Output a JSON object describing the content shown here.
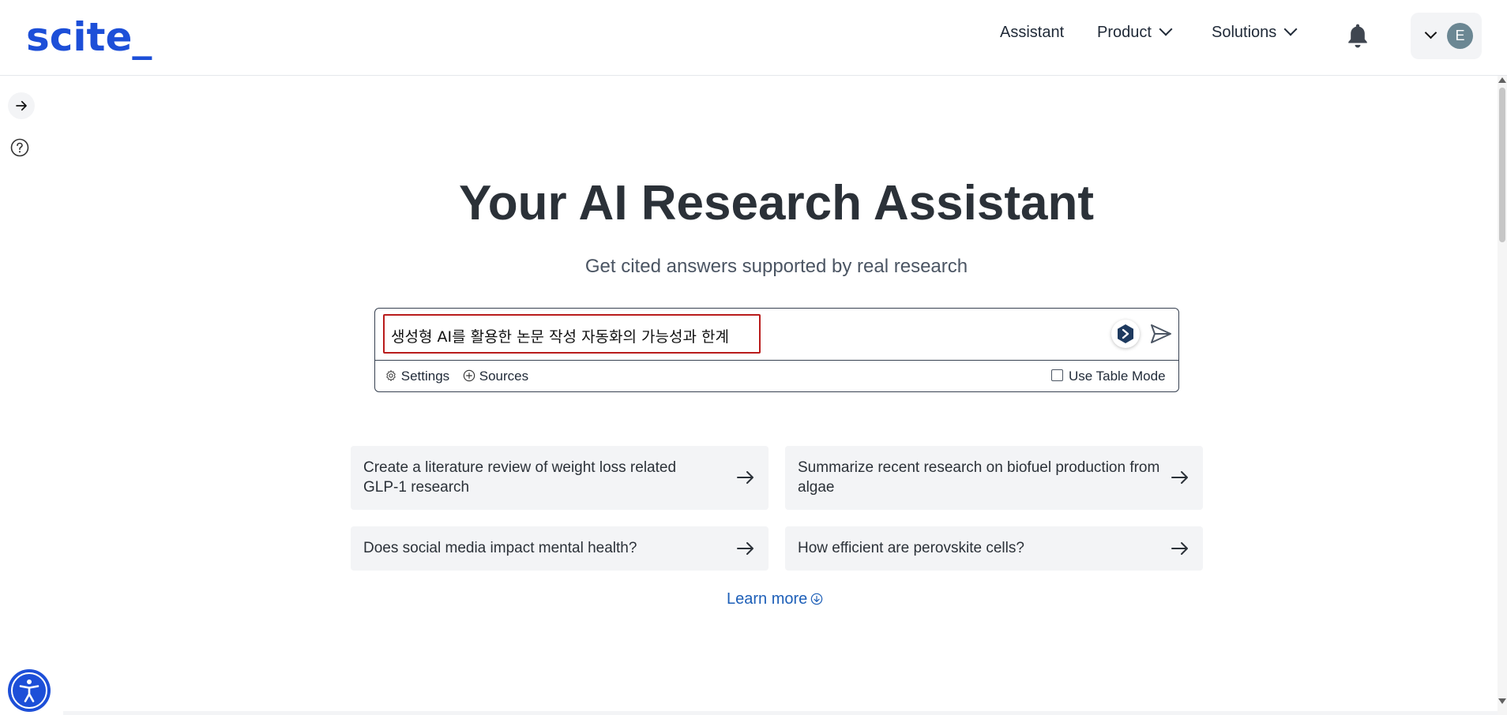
{
  "header": {
    "logo": "scite_",
    "nav": {
      "assistant": "Assistant",
      "product": "Product",
      "solutions": "Solutions"
    },
    "user_initial": "E"
  },
  "hero": {
    "title": "Your AI Research Assistant",
    "subtitle": "Get cited answers supported by real research"
  },
  "search": {
    "value": "생성형 AI를 활용한 논문 작성 자동화의 가능성과 한계",
    "settings_label": "Settings",
    "sources_label": "Sources",
    "table_mode_label": "Use Table Mode",
    "table_mode_checked": false
  },
  "suggestions": [
    {
      "text": "Create a literature review of weight loss related GLP-1 research"
    },
    {
      "text": "Summarize recent research on biofuel production from algae"
    },
    {
      "text": "Does social media impact mental health?"
    },
    {
      "text": "How efficient are perovskite cells?"
    }
  ],
  "learn_more": "Learn more",
  "colors": {
    "brand": "#1d4fd8",
    "title": "#2b3138",
    "card_bg": "#f3f4f6",
    "input_highlight": "#b91c1c",
    "link": "#1d5fb8"
  },
  "icons": [
    "bell-icon",
    "chevron-down-icon",
    "arrow-right-icon",
    "help-icon",
    "accessibility-icon",
    "gear-icon",
    "plus-circle-icon",
    "send-icon",
    "scite-logo-icon",
    "download-circle-icon"
  ]
}
